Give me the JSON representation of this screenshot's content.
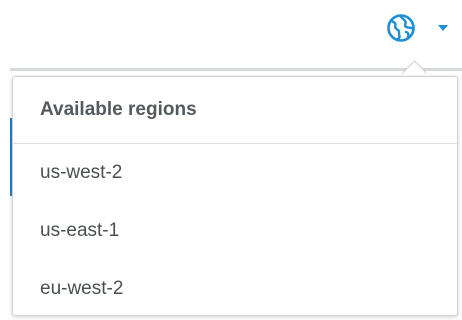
{
  "header": {
    "region_selector_icon": "globe-icon",
    "dropdown_indicator_icon": "caret-down-icon",
    "accent_color": "#1b8fd8"
  },
  "dropdown": {
    "heading": "Available regions",
    "regions": [
      {
        "label": "us-west-2"
      },
      {
        "label": "us-east-1"
      },
      {
        "label": "eu-west-2"
      }
    ]
  }
}
